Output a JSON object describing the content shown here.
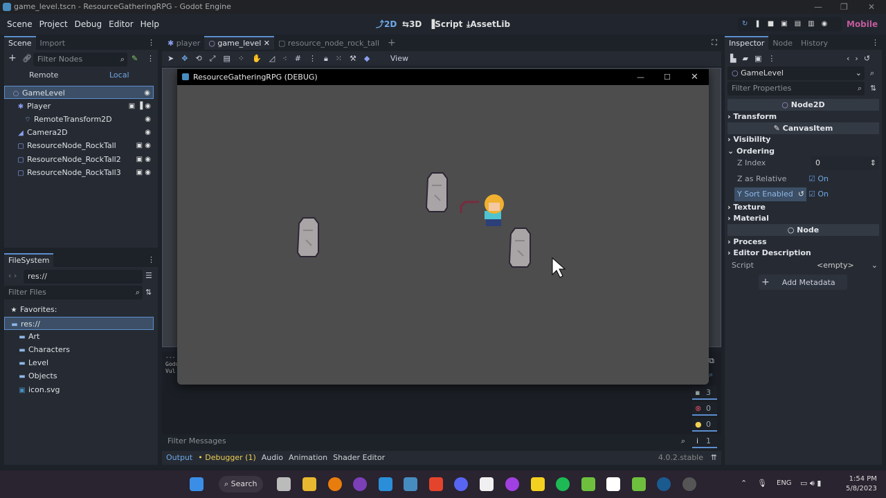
{
  "window": {
    "title": "game_level.tscn - ResourceGatheringRPG - Godot Engine"
  },
  "menu": [
    "Scene",
    "Project",
    "Debug",
    "Editor",
    "Help"
  ],
  "workspaces": {
    "2d": "2D",
    "3d": "3D",
    "script": "Script",
    "assetlib": "AssetLib"
  },
  "renderer": "Mobile",
  "scene_dock": {
    "tabs": [
      "Scene",
      "Import"
    ],
    "filter_placeholder": "Filter Nodes",
    "remote": "Remote",
    "local": "Local",
    "nodes": [
      {
        "label": "GameLevel",
        "selected": true
      },
      {
        "label": "Player"
      },
      {
        "label": "RemoteTransform2D"
      },
      {
        "label": "Camera2D"
      },
      {
        "label": "ResourceNode_RockTall"
      },
      {
        "label": "ResourceNode_RockTall2"
      },
      {
        "label": "ResourceNode_RockTall3"
      }
    ]
  },
  "filesystem": {
    "title": "FileSystem",
    "path": "res://",
    "filter_placeholder": "Filter Files",
    "favorites": "Favorites:",
    "items": [
      "res://",
      "Art",
      "Characters",
      "Level",
      "Objects",
      "icon.svg"
    ]
  },
  "editor_tabs": [
    {
      "label": "player"
    },
    {
      "label": "game_level",
      "active": true
    },
    {
      "label": "resource_node_rock_tall"
    }
  ],
  "toolbar": {
    "view": "View"
  },
  "game_window": {
    "title": "ResourceGatheringRPG (DEBUG)"
  },
  "bottom": {
    "filter_placeholder": "Filter Messages",
    "tabs": [
      "Output",
      "Debugger (1)",
      "Audio",
      "Animation",
      "Shader Editor"
    ],
    "version": "4.0.2.stable",
    "output_lines": [
      "---",
      "Godo",
      "Vul"
    ],
    "counts": {
      "messages": "3",
      "errors": "0",
      "warnings": "0",
      "info": "1"
    }
  },
  "inspector": {
    "tabs": [
      "Inspector",
      "Node",
      "History"
    ],
    "object": "GameLevel",
    "filter_placeholder": "Filter Properties",
    "sections": {
      "node2d": "Node2D",
      "transform": "Transform",
      "canvasitem": "CanvasItem",
      "visibility": "Visibility",
      "ordering": "Ordering",
      "texture": "Texture",
      "material": "Material",
      "node": "Node",
      "process": "Process",
      "editor_description": "Editor Description"
    },
    "props": {
      "z_index_label": "Z Index",
      "z_index": "0",
      "z_rel_label": "Z as Relative",
      "z_rel": "On",
      "ysort_label": "Y Sort Enabled",
      "ysort": "On",
      "script_label": "Script",
      "script": "<empty>"
    },
    "add_metadata": "Add Metadata"
  },
  "taskbar": {
    "search": "Search",
    "lang": "ENG",
    "time": "1:54 PM",
    "date": "5/8/2023"
  },
  "colors": {
    "accent": "#5d8fcf",
    "game_bg": "#4d4d4d",
    "renderer": "#c25b9c"
  }
}
